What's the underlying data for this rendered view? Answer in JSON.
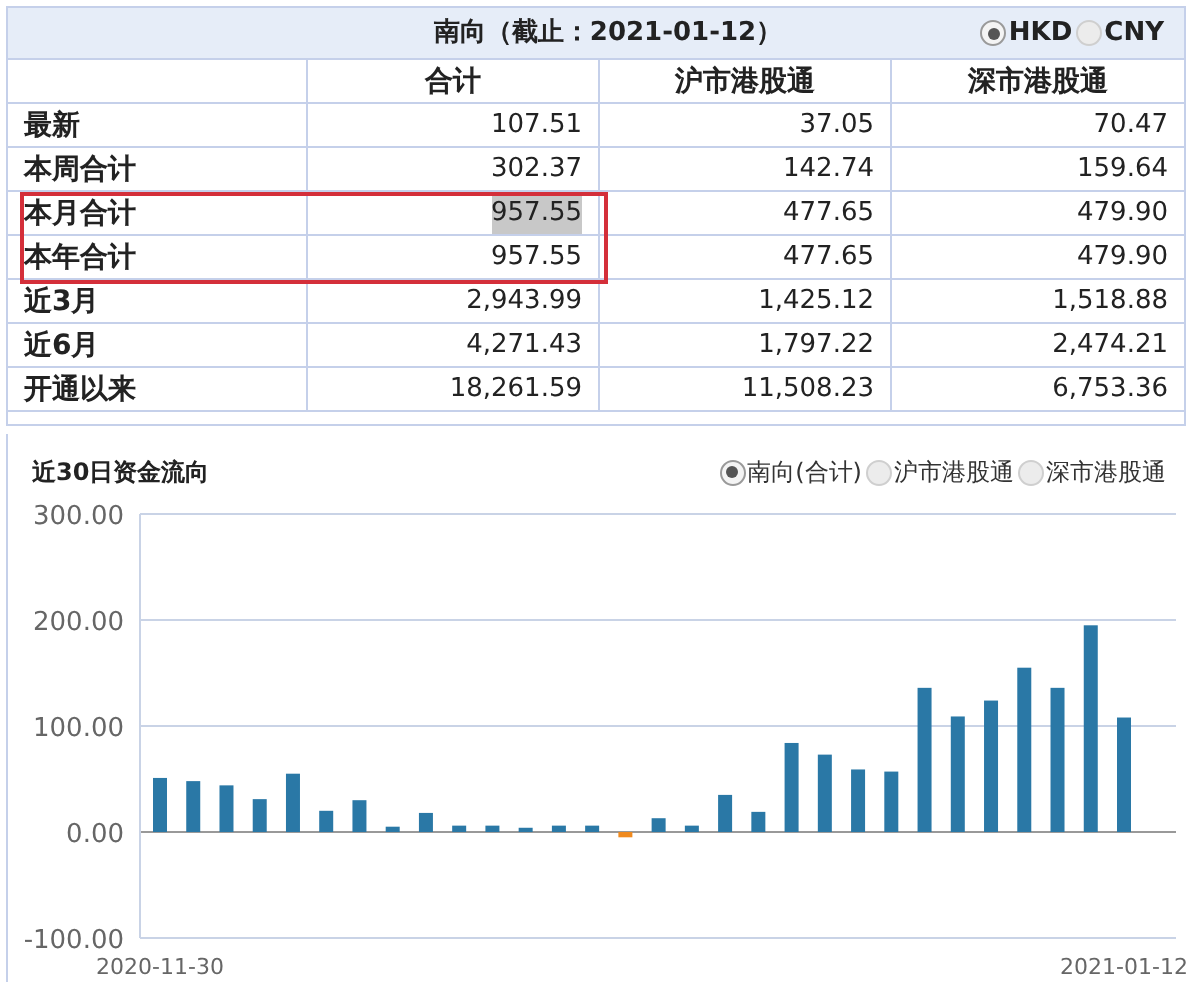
{
  "summary": {
    "title": "南向（截止：2021-01-12）",
    "currency_options": [
      {
        "label": "HKD",
        "selected": true
      },
      {
        "label": "CNY",
        "selected": false
      }
    ],
    "columns": [
      "合计",
      "沪市港股通",
      "深市港股通"
    ],
    "rows": [
      {
        "label": "最新",
        "values": [
          "107.51",
          "37.05",
          "70.47"
        ],
        "boxed": false,
        "highlighted_total": false
      },
      {
        "label": "本周合计",
        "values": [
          "302.37",
          "142.74",
          "159.64"
        ],
        "boxed": false,
        "highlighted_total": false
      },
      {
        "label": "本月合计",
        "values": [
          "957.55",
          "477.65",
          "479.90"
        ],
        "boxed": true,
        "highlighted_total": true
      },
      {
        "label": "本年合计",
        "values": [
          "957.55",
          "477.65",
          "479.90"
        ],
        "boxed": true,
        "highlighted_total": false
      },
      {
        "label": "近3月",
        "values": [
          "2,943.99",
          "1,425.12",
          "1,518.88"
        ],
        "boxed": false,
        "highlighted_total": false
      },
      {
        "label": "近6月",
        "values": [
          "4,271.43",
          "1,797.22",
          "2,474.21"
        ],
        "boxed": false,
        "highlighted_total": false
      },
      {
        "label": "开通以来",
        "values": [
          "18,261.59",
          "11,508.23",
          "6,753.36"
        ],
        "boxed": false,
        "highlighted_total": false
      }
    ]
  },
  "flow": {
    "title": "近30日资金流向",
    "options": [
      {
        "label": "南向(合计)",
        "selected": true
      },
      {
        "label": "沪市港股通",
        "selected": false
      },
      {
        "label": "深市港股通",
        "selected": false
      }
    ],
    "chart_data": {
      "type": "bar",
      "x": [
        "2020-11-30",
        null,
        null,
        null,
        null,
        null,
        null,
        null,
        null,
        null,
        null,
        null,
        null,
        null,
        null,
        null,
        null,
        null,
        null,
        null,
        null,
        null,
        null,
        null,
        null,
        null,
        null,
        null,
        null,
        "2021-01-12"
      ],
      "series": [
        {
          "color": "#2a78a6",
          "values": [
            51,
            48,
            44,
            31,
            55,
            20,
            30,
            5,
            18,
            6,
            6,
            4,
            6,
            6,
            null,
            13,
            6,
            35,
            19,
            84,
            73,
            59,
            57,
            136,
            109,
            124,
            155,
            136,
            195,
            108
          ]
        },
        {
          "color": "#f08a1e",
          "values": [
            null,
            null,
            null,
            null,
            null,
            null,
            null,
            null,
            null,
            null,
            null,
            null,
            null,
            null,
            -5,
            null,
            null,
            null,
            null,
            null,
            null,
            null,
            null,
            null,
            null,
            null,
            null,
            null,
            null,
            null
          ]
        }
      ],
      "ylim": [
        -100,
        300
      ],
      "yticks": [
        {
          "value": 300,
          "label": "300.00"
        },
        {
          "value": 200,
          "label": "200.00"
        },
        {
          "value": 100,
          "label": "100.00"
        },
        {
          "value": 0,
          "label": "0.00"
        },
        {
          "value": -100,
          "label": "-100.00"
        }
      ]
    }
  }
}
